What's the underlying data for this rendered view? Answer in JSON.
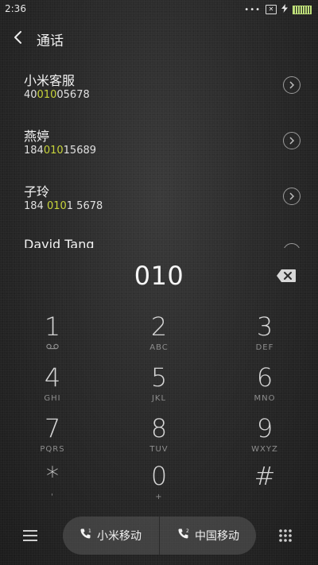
{
  "status_bar": {
    "time": "2:36",
    "dots": "•••",
    "sim_mark": "✕"
  },
  "header": {
    "title": "通话"
  },
  "contacts": [
    {
      "name": "小米客服",
      "number_parts": [
        "40",
        "010",
        "05678"
      ]
    },
    {
      "name": "燕婷",
      "number_parts": [
        "184",
        "010",
        "15689"
      ]
    },
    {
      "name": "子玲",
      "number_parts": [
        "184 ",
        "010",
        "1 5678"
      ]
    },
    {
      "name": "David Tang",
      "number_parts": [
        "",
        "",
        ""
      ]
    }
  ],
  "dialer": {
    "number": "010"
  },
  "keypad": [
    {
      "digit": "1",
      "letters": ""
    },
    {
      "digit": "2",
      "letters": "ABC"
    },
    {
      "digit": "3",
      "letters": "DEF"
    },
    {
      "digit": "4",
      "letters": "GHI"
    },
    {
      "digit": "5",
      "letters": "JKL"
    },
    {
      "digit": "6",
      "letters": "MNO"
    },
    {
      "digit": "7",
      "letters": "PQRS"
    },
    {
      "digit": "8",
      "letters": "TUV"
    },
    {
      "digit": "9",
      "letters": "WXYZ"
    },
    {
      "digit": "*",
      "letters": "'"
    },
    {
      "digit": "0",
      "letters": "+"
    },
    {
      "digit": "#",
      "letters": ""
    }
  ],
  "bottom_bar": {
    "sim1_label": "小米移动",
    "sim1_index": "1",
    "sim2_label": "中国移动",
    "sim2_index": "2"
  },
  "colors": {
    "highlight": "#c8d43a",
    "battery": "#bfe07a"
  },
  "icons": [
    "back-arrow-icon",
    "chevron-right-icon",
    "backspace-icon",
    "voicemail-icon",
    "menu-icon",
    "phone-icon",
    "dialpad-icon",
    "battery-icon",
    "charging-icon"
  ]
}
